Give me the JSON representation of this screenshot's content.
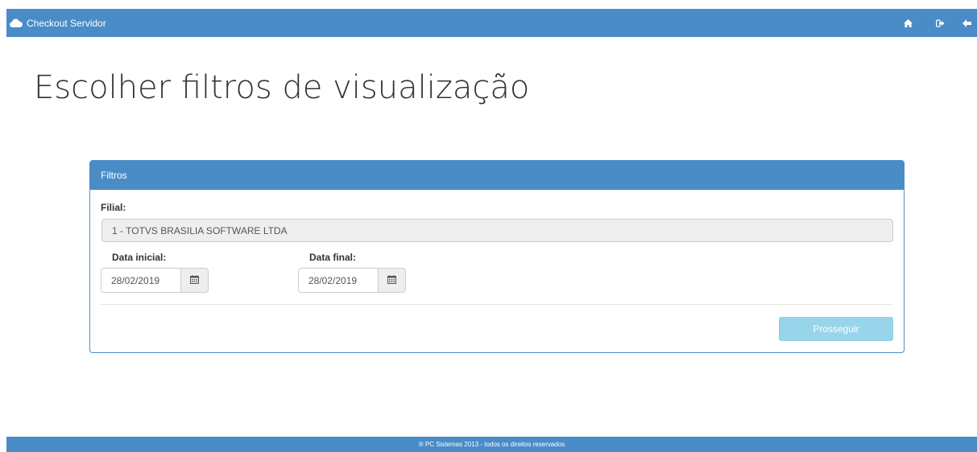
{
  "navbar": {
    "brand_label": "Checkout Servidor",
    "brand_icon": "cloud-icon",
    "icons": [
      "home-icon",
      "logout-icon",
      "back-arrow-icon"
    ]
  },
  "page": {
    "title": "Escolher filtros de visualização"
  },
  "panel": {
    "heading": "Filtros",
    "filial_label": "Filial:",
    "filial_value": "1 - TOTVS BRASILIA SOFTWARE LTDA",
    "data_inicial_label": "Data inicial:",
    "data_inicial_value": "28/02/2019",
    "data_final_label": "Data final:",
    "data_final_value": "28/02/2019",
    "calendar_icon": "calendar-icon",
    "submit_label": "Prosseguir"
  },
  "footer": {
    "text": "® PC Sistemas 2013 - todos os direitos reservados"
  },
  "colors": {
    "primary": "#4a8cc7",
    "button_disabled": "#98d5ea",
    "readonly_bg": "#eeeeee"
  }
}
